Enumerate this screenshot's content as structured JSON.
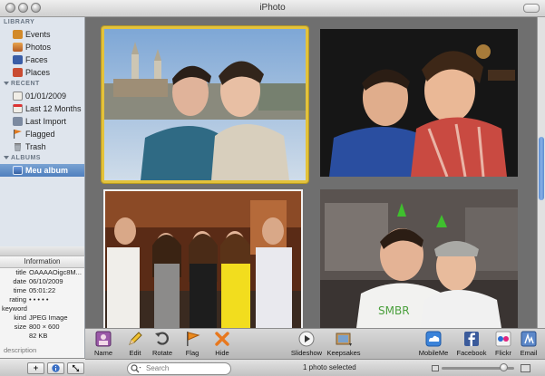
{
  "window": {
    "title": "iPhoto"
  },
  "sidebar": {
    "library_label": "LIBRARY",
    "library": [
      {
        "label": "Events",
        "icon": "events-icon",
        "color": "#d28a2a"
      },
      {
        "label": "Photos",
        "icon": "photos-icon",
        "color": "#c9722d"
      },
      {
        "label": "Faces",
        "icon": "faces-icon",
        "color": "#3a5da6"
      },
      {
        "label": "Places",
        "icon": "places-icon",
        "color": "#c94c32"
      }
    ],
    "recent_label": "RECENT",
    "recent": [
      {
        "label": "01/01/2009",
        "icon": "calendar-icon",
        "color": "#f0ede6"
      },
      {
        "label": "Last 12 Months",
        "icon": "calendar-icon",
        "color": "#f0ede6"
      },
      {
        "label": "Last Import",
        "icon": "import-icon",
        "color": "#7c8aa0"
      },
      {
        "label": "Flagged",
        "icon": "flag-icon",
        "color": "#e07a20"
      },
      {
        "label": "Trash",
        "icon": "trash-icon",
        "color": "#9aa1a8"
      }
    ],
    "albums_label": "ALBUMS",
    "albums": [
      {
        "label": "Meu album",
        "icon": "album-icon",
        "color": "#4a72b8",
        "selected": true
      }
    ]
  },
  "info": {
    "header": "Information",
    "rows": [
      {
        "key": "title",
        "value": "OAAAAOigc8M..."
      },
      {
        "key": "date",
        "value": "06/10/2009"
      },
      {
        "key": "time",
        "value": "05:01:22"
      },
      {
        "key": "rating",
        "value": "• • • • •"
      },
      {
        "key": "keyword",
        "value": ""
      },
      {
        "key": "kind",
        "value": "JPEG Image"
      },
      {
        "key": "size",
        "value": "800 × 600"
      },
      {
        "key": "",
        "value": "82 KB"
      }
    ],
    "description_placeholder": "description"
  },
  "toolbar": {
    "buttons": [
      {
        "label": "Name",
        "icon": "name-icon"
      },
      {
        "label": "Edit",
        "icon": "edit-pencil-icon"
      },
      {
        "label": "Rotate",
        "icon": "rotate-icon"
      },
      {
        "label": "Flag",
        "icon": "flag-icon"
      },
      {
        "label": "Hide",
        "icon": "hide-x-icon"
      },
      {
        "label": "Slideshow",
        "icon": "play-icon"
      },
      {
        "label": "Keepsakes",
        "icon": "keepsakes-icon"
      },
      {
        "label": "MobileMe",
        "icon": "mobileme-icon"
      },
      {
        "label": "Facebook",
        "icon": "facebook-icon"
      },
      {
        "label": "Flickr",
        "icon": "flickr-icon"
      },
      {
        "label": "Email",
        "icon": "email-icon"
      }
    ]
  },
  "search": {
    "placeholder": "Search"
  },
  "status": {
    "text": "1 photo selected"
  },
  "zoom": {
    "level": 0.9
  },
  "photos": [
    {
      "name": "photo-two-guys-outdoors",
      "selected": true
    },
    {
      "name": "photo-two-guys-night",
      "selected": false
    },
    {
      "name": "photo-group-five",
      "selected": false
    },
    {
      "name": "photo-two-guys-party",
      "selected": false
    }
  ],
  "colors": {
    "selection": "#e3c23b",
    "accent": "#4f7fbe"
  }
}
